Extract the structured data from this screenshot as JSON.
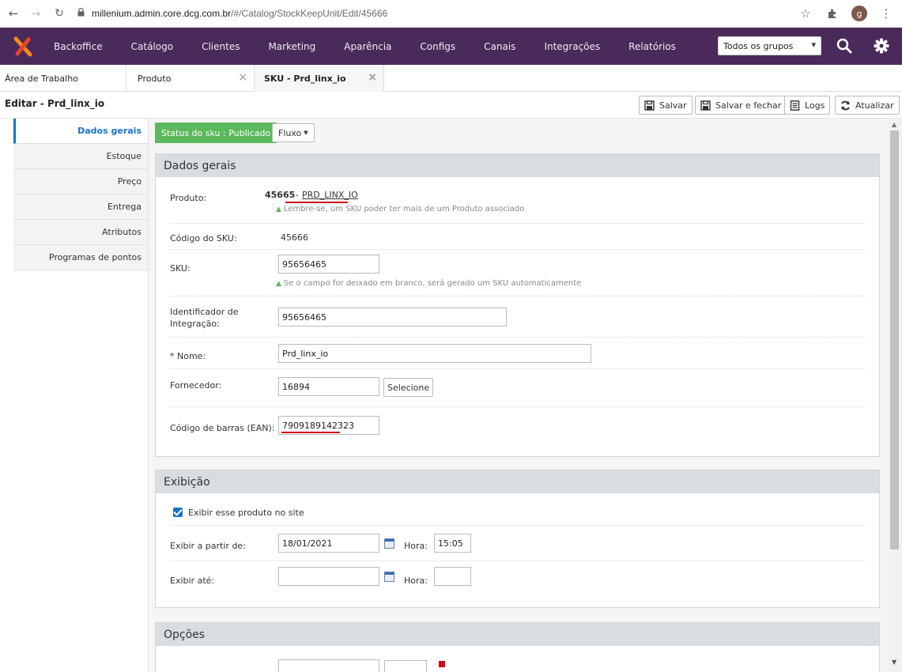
{
  "browser": {
    "url_host": "millenium.admin.core.dcg.com.br",
    "url_path": "/#/Catalog/StockKeepUnit/Edit/45666",
    "profile_initial": "g"
  },
  "topnav": {
    "items": [
      "Backoffice",
      "Catálogo",
      "Clientes",
      "Marketing",
      "Aparência",
      "Configs",
      "Canais",
      "Integrações",
      "Relatórios"
    ],
    "group_select": "Todos os grupos"
  },
  "tabs": [
    {
      "label": "Área de Trabalho"
    },
    {
      "label": "Produto"
    },
    {
      "label": "SKU - Prd_linx_io"
    }
  ],
  "header": {
    "title": "Editar - Prd_linx_io",
    "buttons": {
      "save": "Salvar",
      "save_close": "Salvar e fechar",
      "logs": "Logs",
      "refresh": "Atualizar"
    }
  },
  "sidenav": [
    "Dados gerais",
    "Estoque",
    "Preço",
    "Entrega",
    "Atributos",
    "Programas de pontos"
  ],
  "status": {
    "text": "Status do sku : Publicado",
    "fluxo": "Fluxo"
  },
  "dados_gerais": {
    "title": "Dados gerais",
    "produto_label": "Produto:",
    "produto_id": "45665",
    "produto_sep": " - ",
    "produto_name": "PRD_LINX_IO",
    "produto_hint": "Lembre-se, um SKU poder ter mais de um Produto associado",
    "codigo_label": "Código do SKU:",
    "codigo_value": "45666",
    "sku_label": "SKU:",
    "sku_value": "95656465",
    "sku_hint": "Se o campo for deixado em branco, será gerado um SKU automaticamente",
    "ident_label_1": "Identificador de",
    "ident_label_2": "Integração:",
    "ident_value": "95656465",
    "nome_label": "* Nome:",
    "nome_value": "Prd_linx_io",
    "fornecedor_label": "Fornecedor:",
    "fornecedor_value": "16894",
    "fornecedor_button": "Selecione",
    "ean_label": "Código de barras (EAN):",
    "ean_value": "7909189142323"
  },
  "exibicao": {
    "title": "Exibição",
    "checkbox_label": "Exibir esse produto no site",
    "from_label": "Exibir a partir de:",
    "from_date": "18/01/2021",
    "hora_label": "Hora:",
    "from_time": "15:05",
    "until_label": "Exibir até:",
    "until_date": "",
    "until_time": ""
  },
  "opcoes": {
    "title": "Opções"
  },
  "colors": {
    "topnav_bg": "#4a2a5a",
    "status_green": "#5cb85c",
    "accent_blue": "#1a73c8",
    "underline_red": "#d0021b"
  }
}
